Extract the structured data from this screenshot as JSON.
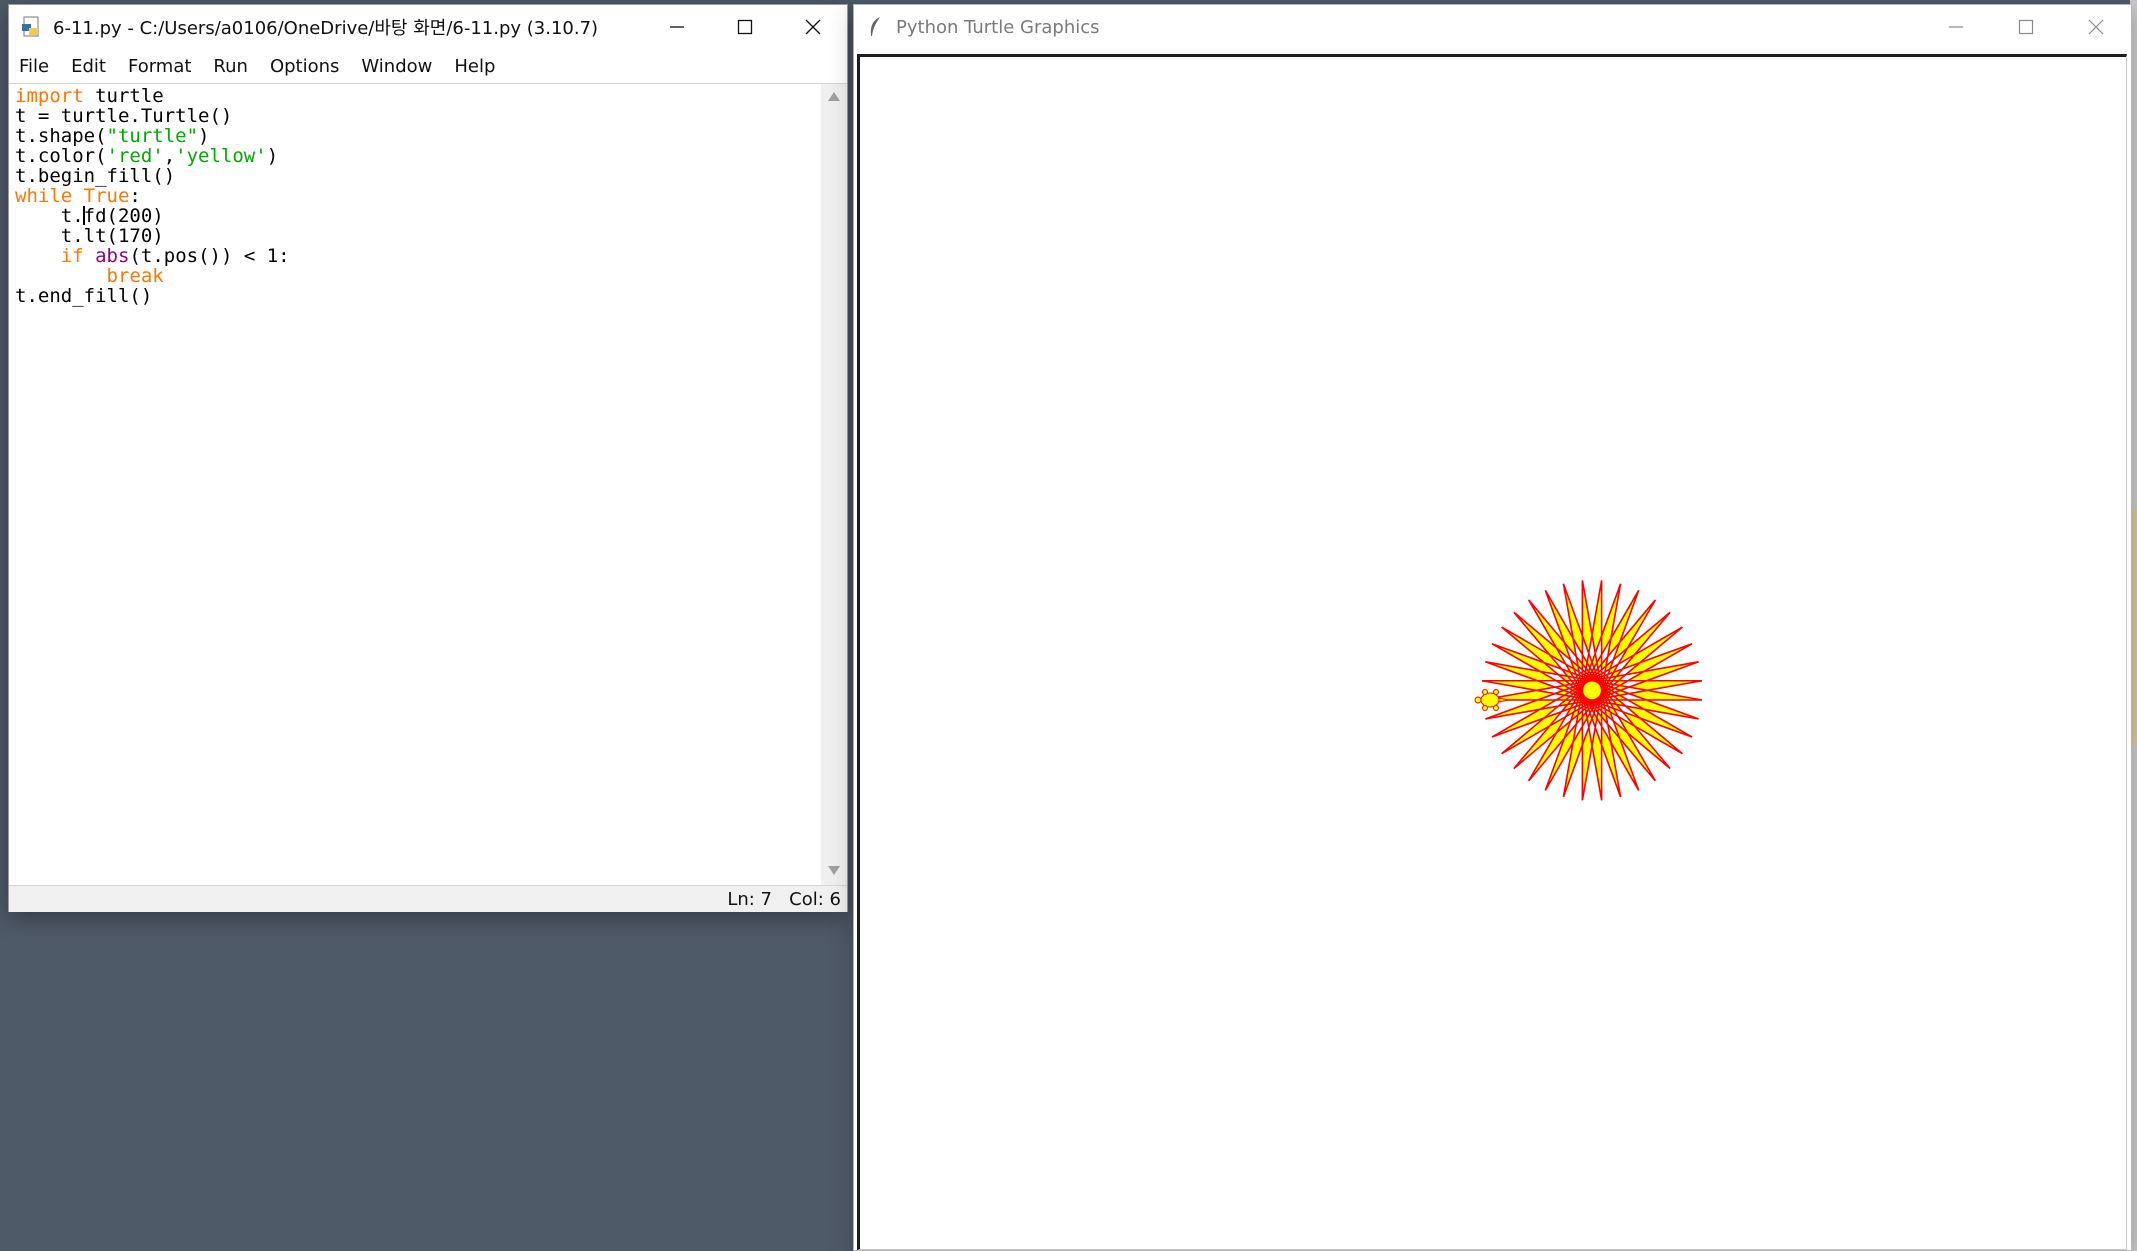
{
  "idle": {
    "title": "6-11.py - C:/Users/a0106/OneDrive/바탕 화면/6-11.py (3.10.7)",
    "menu": [
      "File",
      "Edit",
      "Format",
      "Run",
      "Options",
      "Window",
      "Help"
    ],
    "status": "Ln: 7   Col: 6"
  },
  "code": {
    "line1": {
      "kw": "import",
      "rest": " turtle"
    },
    "line2": "t = turtle.Turtle()",
    "line3": {
      "pre": "t.shape(",
      "str": "\"turtle\"",
      "post": ")"
    },
    "line4": {
      "pre": "t.color(",
      "str1": "'red'",
      "sep": ",",
      "str2": "'yellow'",
      "post": ")"
    },
    "line5": "t.begin_fill()",
    "line6": {
      "kw1": "while",
      "sp": " ",
      "kw2": "True",
      "post": ":"
    },
    "line7": {
      "indent": "    ",
      "before": "t.",
      "after": "fd(200)"
    },
    "line8": "    t.lt(170)",
    "line9": {
      "indent": "    ",
      "kw": "if",
      "sp": " ",
      "bi": "abs",
      "post": "(t.pos()) < 1:"
    },
    "line10": {
      "indent": "        ",
      "kw": "break"
    },
    "line11": "t.end_fill()"
  },
  "turtle_window": {
    "title": "Python Turtle Graphics"
  },
  "drawing": {
    "step": 200,
    "turn_deg": 170,
    "pen_color": "#ff0000",
    "fill_color": "#ffff00"
  },
  "colors": {
    "keyword": "#ff7700",
    "string": "#00aa00",
    "builtin": "#900090"
  }
}
